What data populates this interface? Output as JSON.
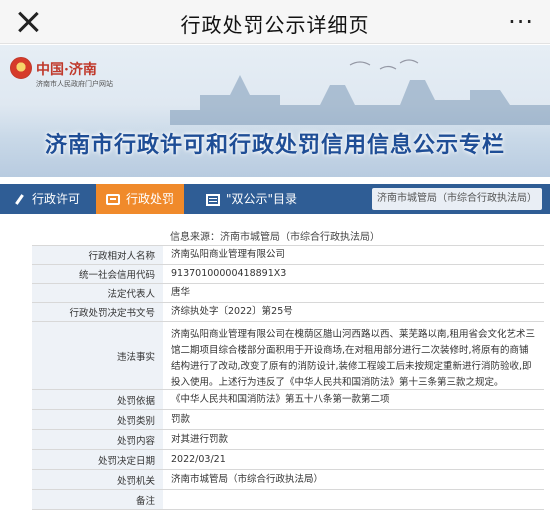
{
  "topbar": {
    "title": "行政处罚公示详细页",
    "more": "···"
  },
  "banner": {
    "logo_name": "中国·济南",
    "logo_sub": "济南市人民政府门户网站",
    "headline": "济南市行政许可和行政处罚信用信息公示专栏"
  },
  "nav": {
    "items": [
      {
        "label": "行政许可",
        "icon": "pen-icon"
      },
      {
        "label": "行政处罚",
        "icon": "box-icon"
      },
      {
        "label": "\"双公示\"目录",
        "icon": "calendar-icon"
      }
    ],
    "right": "济南市城管局（市综合行政执法局）"
  },
  "source": "信息来源：济南市城管局（市综合行政执法局）",
  "rows": [
    {
      "label": "行政相对人名称",
      "value": "济南弘阳商业管理有限公司"
    },
    {
      "label": "统一社会信用代码",
      "value": "91370100000418891X3"
    },
    {
      "label": "法定代表人",
      "value": "唐华"
    },
    {
      "label": "行政处罚决定书文号",
      "value": "济综执处字〔2022〕第25号"
    },
    {
      "label": "违法事实",
      "value": "济南弘阳商业管理有限公司在槐荫区腊山河西路以西、莱芜路以南,租用省会文化艺术三馆二期项目综合楼部分面积用于开设商场,在对租用部分进行二次装修时,将原有的商铺结构进行了改动,改变了原有的消防设计,装修工程竣工后未按规定重新进行消防验收,即投入使用。上述行为违反了《中华人民共和国消防法》第十三条第三款之规定。"
    },
    {
      "label": "处罚依据",
      "value": "《中华人民共和国消防法》第五十八条第一款第二项"
    },
    {
      "label": "处罚类别",
      "value": "罚款"
    },
    {
      "label": "处罚内容",
      "value": "对其进行罚款"
    },
    {
      "label": "处罚决定日期",
      "value": "2022/03/21"
    },
    {
      "label": "处罚机关",
      "value": "济南市城管局（市综合行政执法局）"
    },
    {
      "label": "备注",
      "value": ""
    }
  ]
}
